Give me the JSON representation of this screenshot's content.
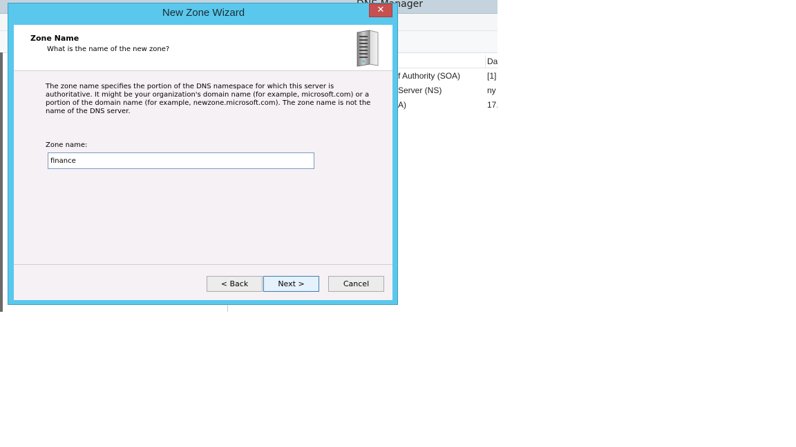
{
  "background_window": {
    "title": "DNS Manager",
    "records": [
      {
        "type": "f Authority (SOA)",
        "data": "[1]"
      },
      {
        "type": "Server (NS)",
        "data": "ny"
      },
      {
        "type": "A)",
        "data": "17."
      }
    ],
    "data_header": "Da"
  },
  "dialog": {
    "title": "New Zone Wizard",
    "close_glyph": "✕",
    "heading": "Zone Name",
    "subheading": "What is the name of the new zone?",
    "description": "The zone name specifies the portion of the DNS namespace for which this server is authoritative. It might be your organization's domain name (for example,  microsoft.com) or a portion of the domain name (for example, newzone.microsoft.com). The zone name is not the name of the DNS server.",
    "zone_name_label": "Zone name:",
    "zone_name_value": "finance",
    "buttons": {
      "back": "< Back",
      "next": "Next >",
      "cancel": "Cancel"
    },
    "icon": "server-icon"
  },
  "colors": {
    "dialog_frame": "#5ac8ec",
    "close_button": "#c75050",
    "client_bg": "#f6f1f5"
  }
}
